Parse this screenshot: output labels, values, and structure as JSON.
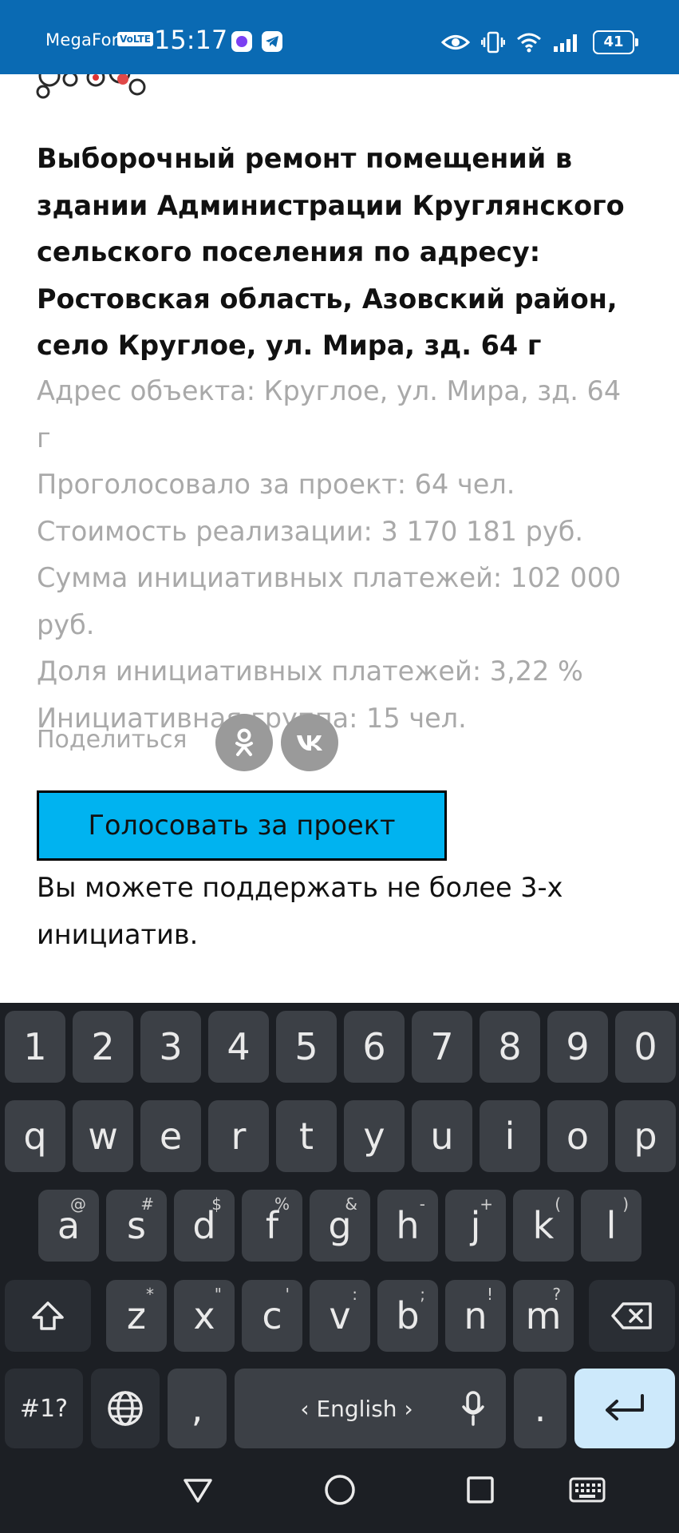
{
  "status_bar": {
    "carrier": "MegaFon",
    "volte": "VoLTE",
    "time": "15:17",
    "battery": "41"
  },
  "project": {
    "title": "Выборочный ремонт помещений в здании Администрации Круглянского сельского поселения по адресу: Ростовская область, Азовский район, село Круглое, ул. Мира, зд. 64 г",
    "address": "Адрес объекта: Круглое, ул. Мира, зд. 64 г",
    "votes": "Проголосовало за проект: 64 чел.",
    "cost": "Стоимость реализации: 3 170 181 руб.",
    "payments_sum": "Сумма инициативных платежей: 102 000 руб.",
    "payments_share": "Доля инициативных платежей: 3,22 %",
    "initiative_group": "Инициативная группа: 15 чел."
  },
  "share": {
    "label": "Поделиться",
    "networks": [
      "odnoklassniki-icon",
      "vk-icon"
    ]
  },
  "vote_button": {
    "label": "Голосовать за проект"
  },
  "vote_note": "Вы можете поддержать не более 3-х инициатив.",
  "keyboard": {
    "row_numbers": [
      "1",
      "2",
      "3",
      "4",
      "5",
      "6",
      "7",
      "8",
      "9",
      "0"
    ],
    "row_q": [
      "q",
      "w",
      "e",
      "r",
      "t",
      "y",
      "u",
      "i",
      "o",
      "p"
    ],
    "row_a": [
      {
        "k": "a",
        "s": "@"
      },
      {
        "k": "s",
        "s": "#"
      },
      {
        "k": "d",
        "s": "$"
      },
      {
        "k": "f",
        "s": "%"
      },
      {
        "k": "g",
        "s": "&"
      },
      {
        "k": "h",
        "s": "-"
      },
      {
        "k": "j",
        "s": "+"
      },
      {
        "k": "k",
        "s": "("
      },
      {
        "k": "l",
        "s": ")"
      }
    ],
    "row_z": [
      {
        "k": "z",
        "s": "*"
      },
      {
        "k": "x",
        "s": "\""
      },
      {
        "k": "c",
        "s": "'"
      },
      {
        "k": "v",
        "s": ":"
      },
      {
        "k": "b",
        "s": ";"
      },
      {
        "k": "n",
        "s": "!"
      },
      {
        "k": "m",
        "s": "?"
      }
    ],
    "symbols_label": "#1?",
    "comma": ",",
    "space_label": "‹ English ›",
    "period": "."
  },
  "colors": {
    "status_bar": "#0a6ab3",
    "vote_button": "#00b3f0",
    "muted_text": "#a9a9a9",
    "keyboard_bg": "#1c1f24",
    "key_bg": "#3c4046",
    "enter_key": "#cde9fb"
  }
}
